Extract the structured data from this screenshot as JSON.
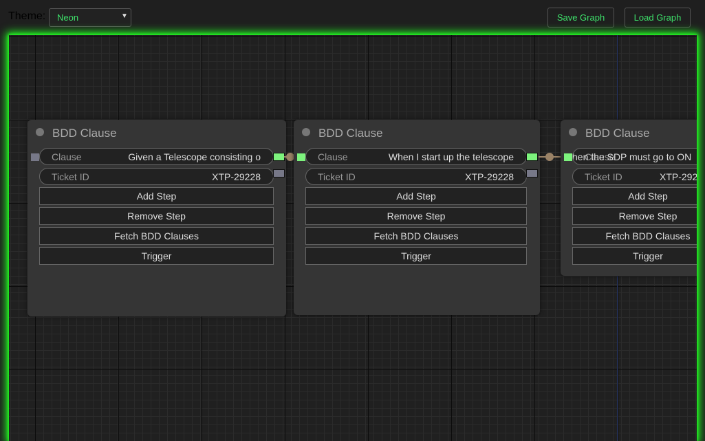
{
  "toolbar": {
    "theme_label": "Theme:",
    "theme_selected": "Neon",
    "save_label": "Save Graph",
    "load_label": "Load Graph"
  },
  "nodes": [
    {
      "title": "BDD Clause",
      "clause_label": "Clause",
      "clause_value": "Given a Telescope consisting o",
      "ticket_label": "Ticket ID",
      "ticket_value": "XTP-29228",
      "buttons": [
        "Add Step",
        "Remove Step",
        "Fetch BDD Clauses",
        "Trigger"
      ]
    },
    {
      "title": "BDD Clause",
      "clause_label": "Clause",
      "clause_value": "When I start up the telescope",
      "ticket_label": "Ticket ID",
      "ticket_value": "XTP-29228",
      "buttons": [
        "Add Step",
        "Remove Step",
        "Fetch BDD Clauses",
        "Trigger"
      ]
    },
    {
      "title": "BDD Clause",
      "clause_label": "Clause",
      "clause_value": "hen the SDP must go to ON",
      "ticket_label": "Ticket ID",
      "ticket_value": "XTP-292",
      "buttons": [
        "Add Step",
        "Remove Step",
        "Fetch BDD Clauses",
        "Trigger"
      ]
    }
  ],
  "colors": {
    "accent": "#3ee06a",
    "glow": "#22ff22",
    "slot_connected": "#7df37d",
    "slot_empty": "#777888",
    "link": "#9a8266"
  }
}
